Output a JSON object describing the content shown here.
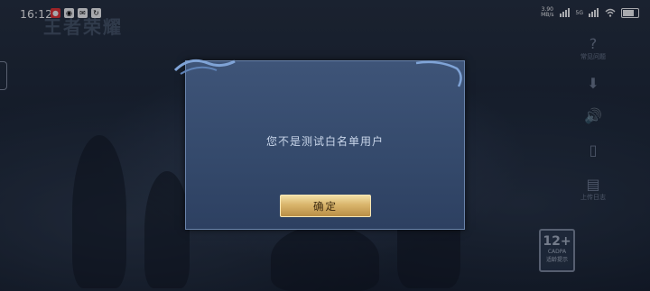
{
  "statusbar": {
    "time": "16:12",
    "netspeed_value": "3.90",
    "netspeed_unit": "MB/s",
    "network": "5G"
  },
  "background": {
    "logo_text": "王者荣耀"
  },
  "right_sidebar": {
    "items": [
      {
        "icon": "question-icon",
        "glyph": "?",
        "label": "常见问题"
      },
      {
        "icon": "download-icon",
        "glyph": "⬇",
        "label": ""
      },
      {
        "icon": "speaker-icon",
        "glyph": "🔊",
        "label": ""
      },
      {
        "icon": "phone-icon",
        "glyph": "▯",
        "label": ""
      },
      {
        "icon": "document-icon",
        "glyph": "▤",
        "label": "上传日志"
      }
    ]
  },
  "age_rating": {
    "value": "12+",
    "sub": "CADPA",
    "label": "适龄提示"
  },
  "dialog": {
    "message": "您不是测试白名单用户",
    "ok_label": "确定"
  }
}
